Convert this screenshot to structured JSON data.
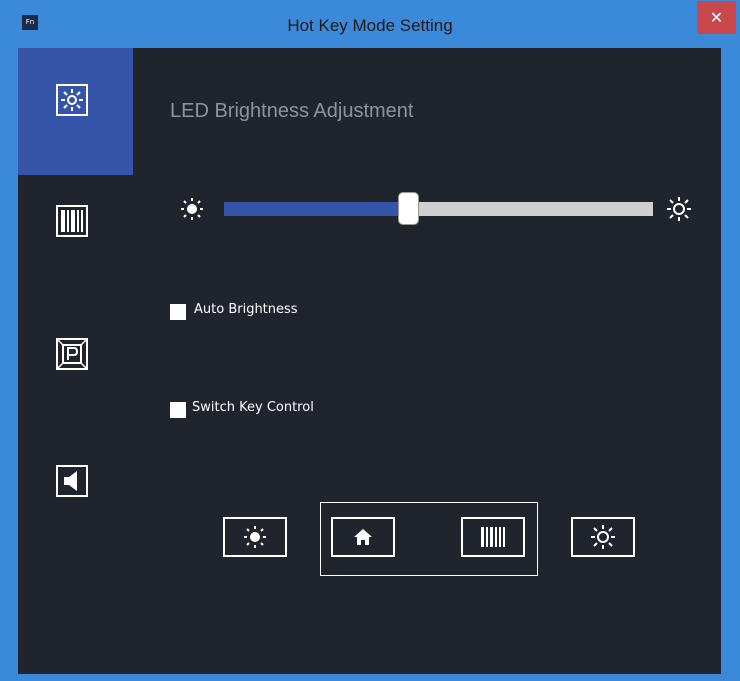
{
  "window": {
    "title": "Hot Key Mode Setting",
    "app_icon_label": "Fn",
    "close_glyph": "✕"
  },
  "sidebar": {
    "items": [
      {
        "name": "brightness",
        "icon": "brightness-icon",
        "active": true
      },
      {
        "name": "barcode",
        "icon": "barcode-icon",
        "active": false
      },
      {
        "name": "parking",
        "icon": "parking-icon",
        "active": false
      },
      {
        "name": "sound",
        "icon": "speaker-icon",
        "active": false
      }
    ]
  },
  "main": {
    "heading": "LED Brightness Adjustment",
    "slider": {
      "value": 0.43,
      "min_icon": "sun-small-icon",
      "max_icon": "sun-large-icon"
    },
    "auto_brightness": {
      "label": "Auto Brightness",
      "checked": false
    },
    "switch_key_control": {
      "label": "Switch Key Control",
      "checked": false
    }
  },
  "keys": [
    {
      "name": "brightness-down",
      "icon": "sun-filled-icon"
    },
    {
      "name": "home",
      "icon": "home-icon"
    },
    {
      "name": "barcode",
      "icon": "barcode-icon"
    },
    {
      "name": "brightness-up",
      "icon": "sun-outline-icon"
    }
  ],
  "colors": {
    "accent": "#3755a8",
    "background": "#1f242d",
    "titlebar": "#3b8ad9",
    "close": "#c9484b"
  }
}
